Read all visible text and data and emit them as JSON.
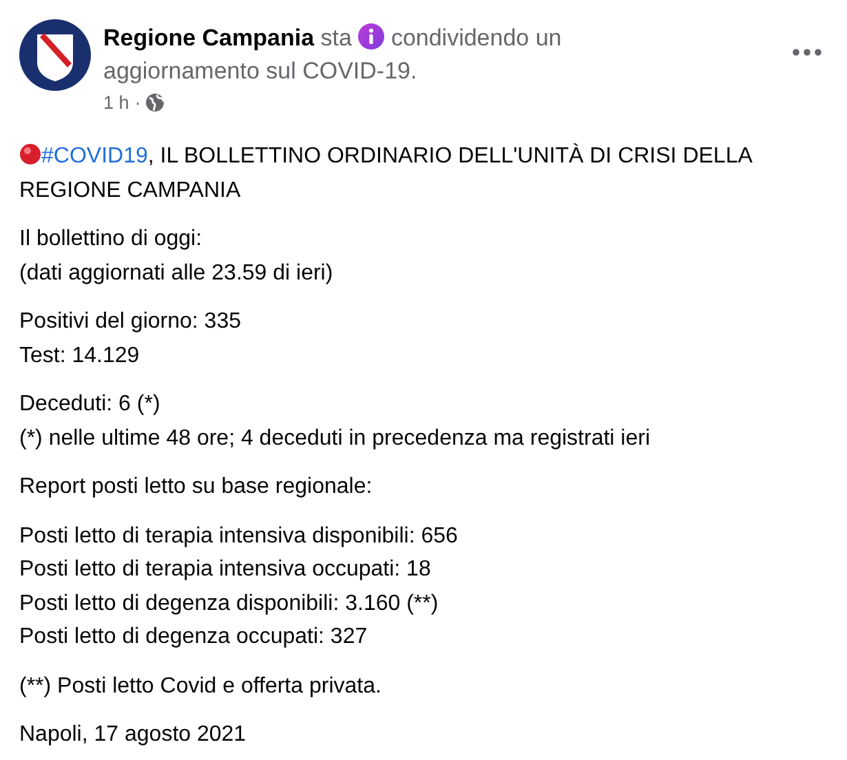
{
  "post": {
    "author": "Regione Campania",
    "activity_verb": "sta",
    "activity": [
      "condividendo un",
      "aggiornamento sul COVID-19."
    ],
    "time": "1 h",
    "separator": "·",
    "title": {
      "hashtag": "#COVID19",
      "text": ", IL BOLLETTINO ORDINARIO DELL'UNITÀ DI CRISI DELLA REGIONE CAMPANIA"
    },
    "paragraphs": [
      [
        "Il bollettino di oggi:",
        "(dati aggiornati alle 23.59 di ieri)"
      ],
      [
        "Positivi del giorno: 335",
        "Test: 14.129"
      ],
      [
        "Deceduti: 6 (*)",
        "(*) nelle ultime 48 ore; 4 deceduti in precedenza ma registrati ieri"
      ],
      [
        "Report posti letto su base regionale:"
      ],
      [
        "Posti letto di terapia intensiva disponibili: 656",
        "Posti letto di terapia intensiva occupati: 18",
        "Posti letto di degenza disponibili: 3.160 (**)",
        "Posti letto di degenza occupati: 327"
      ],
      [
        "(**) Posti letto Covid e offerta privata."
      ],
      [
        "Napoli, 17 agosto 2021"
      ]
    ]
  }
}
